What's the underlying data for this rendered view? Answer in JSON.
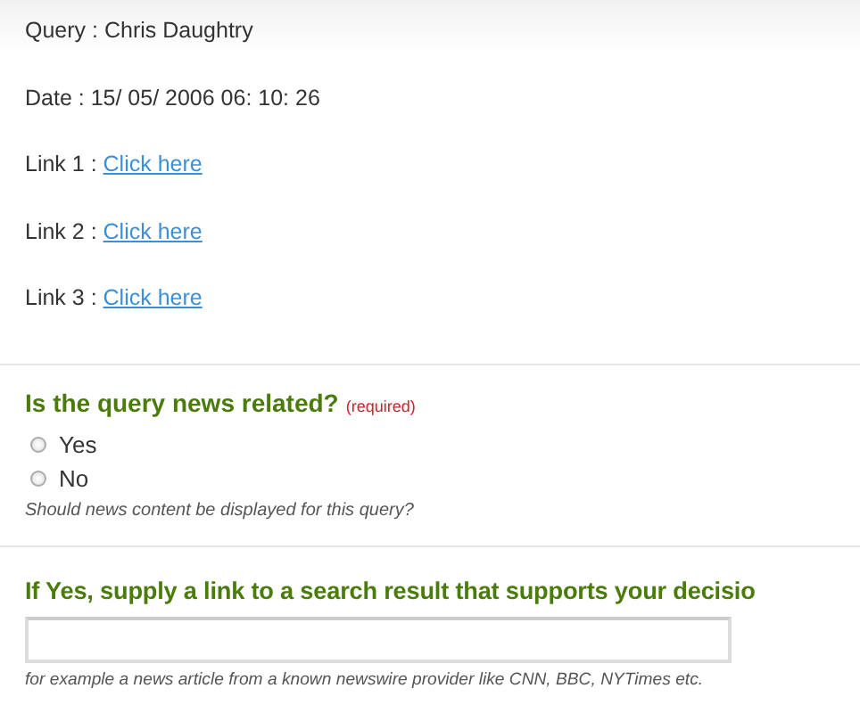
{
  "info_lines": [
    {
      "kind": "text",
      "label": "Query : ",
      "value": "Chris Daughtry"
    },
    {
      "kind": "text",
      "label": "Date : ",
      "value": "15/ 05/ 2006 06: 10: 26"
    },
    {
      "kind": "link",
      "label": "Link 1 : ",
      "value": "Click here"
    },
    {
      "kind": "link",
      "label": "Link 2 : ",
      "value": "Click here"
    },
    {
      "kind": "link",
      "label": "Link 3 : ",
      "value": "Click here"
    }
  ],
  "question": {
    "title": "Is the query news related?",
    "required": "(required)",
    "options": [
      {
        "label": "Yes",
        "selected": false
      },
      {
        "label": "No",
        "selected": false
      }
    ],
    "hint": "Should news content be displayed for this query?"
  },
  "link_question": {
    "title": "If Yes, supply a link to a search result that supports your decisio",
    "hint": "for example a news article from a known newswire provider like CNN, BBC, NYTimes etc."
  }
}
